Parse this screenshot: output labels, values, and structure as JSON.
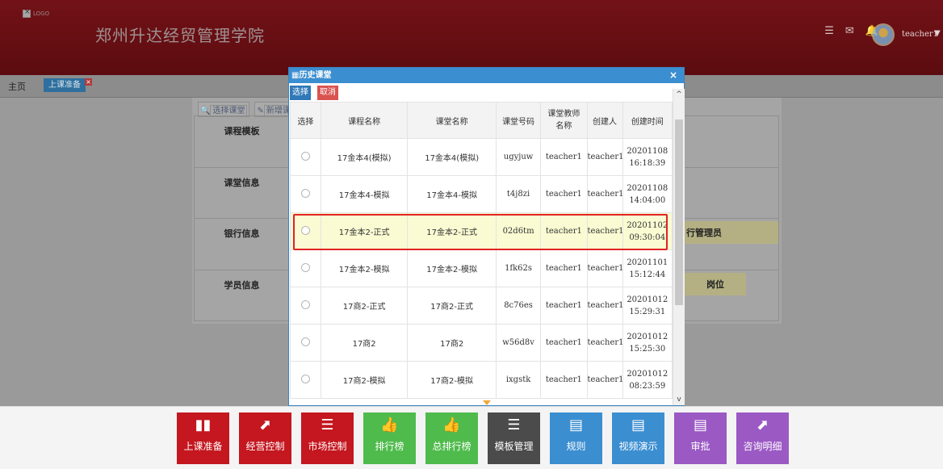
{
  "header": {
    "logo_text": "LOGO",
    "school_name": "郑州升达经贸管理学院",
    "username": "teacher1"
  },
  "tabs": {
    "home": "主页",
    "active": "上课准备"
  },
  "background": {
    "toolbar": {
      "select_course": "选择课堂",
      "new_course": "新增课堂"
    },
    "rows": [
      "课程模板",
      "课堂信息",
      "银行信息",
      "学员信息"
    ],
    "bank_role": "行管理员",
    "position_header": "岗位"
  },
  "modal": {
    "title": "历史课堂",
    "select_button": "选择",
    "cancel_button": "取消",
    "columns": [
      "选择",
      "课程名称",
      "课堂名称",
      "课堂号码",
      "课堂教师名称",
      "创建人",
      "创建时间"
    ],
    "rows": [
      {
        "course_name": "17金本4(模拟)",
        "class_name": "17金本4(模拟)",
        "class_code": "ugyjuw",
        "teacher": "teacher1",
        "creator": "teacher1",
        "date": "20201108",
        "time": "16:18:39"
      },
      {
        "course_name": "17金本4-模拟",
        "class_name": "17金本4-模拟",
        "class_code": "t4j8zi",
        "teacher": "teacher1",
        "creator": "teacher1",
        "date": "20201108",
        "time": "14:04:00"
      },
      {
        "course_name": "17金本2-正式",
        "class_name": "17金本2-正式",
        "class_code": "02d6tm",
        "teacher": "teacher1",
        "creator": "teacher1",
        "date": "20201102",
        "time": "09:30:04"
      },
      {
        "course_name": "17金本2-模拟",
        "class_name": "17金本2-模拟",
        "class_code": "1fk62s",
        "teacher": "teacher1",
        "creator": "teacher1",
        "date": "20201101",
        "time": "15:12:44"
      },
      {
        "course_name": "17商2-正式",
        "class_name": "17商2-正式",
        "class_code": "8c76es",
        "teacher": "teacher1",
        "creator": "teacher1",
        "date": "20201012",
        "time": "15:29:31"
      },
      {
        "course_name": "17商2",
        "class_name": "17商2",
        "class_code": "w56d8v",
        "teacher": "teacher1",
        "creator": "teacher1",
        "date": "20201012",
        "time": "15:25:30"
      },
      {
        "course_name": "17商2-模拟",
        "class_name": "17商2-模拟",
        "class_code": "ixgstk",
        "teacher": "teacher1",
        "creator": "teacher1",
        "date": "20201012",
        "time": "08:23:59"
      }
    ],
    "highlighted_row_index": 2
  },
  "footer": {
    "buttons": [
      {
        "label": "上课准备",
        "icon": "book-icon",
        "glyph": "▮▮",
        "color": "#c4171f"
      },
      {
        "label": "经营控制",
        "icon": "growth-chart-icon",
        "glyph": "⬈",
        "color": "#c4171f"
      },
      {
        "label": "市场控制",
        "icon": "list-icon",
        "glyph": "☰",
        "color": "#c4171f"
      },
      {
        "label": "排行榜",
        "icon": "thumbs-up-icon",
        "glyph": "👍",
        "color": "#4fbb4c"
      },
      {
        "label": "总排行榜",
        "icon": "thumbs-up-icon",
        "glyph": "👍",
        "color": "#4fbb4c"
      },
      {
        "label": "模板管理",
        "icon": "list-icon",
        "glyph": "☰",
        "color": "#4b4b4b"
      },
      {
        "label": "规则",
        "icon": "document-icon",
        "glyph": "▤",
        "color": "#3b8ed0"
      },
      {
        "label": "视频演示",
        "icon": "document-icon",
        "glyph": "▤",
        "color": "#3b8ed0"
      },
      {
        "label": "审批",
        "icon": "document-icon",
        "glyph": "▤",
        "color": "#9b59c4"
      },
      {
        "label": "咨询明细",
        "icon": "growth-chart-icon",
        "glyph": "⬈",
        "color": "#9b59c4"
      }
    ]
  }
}
